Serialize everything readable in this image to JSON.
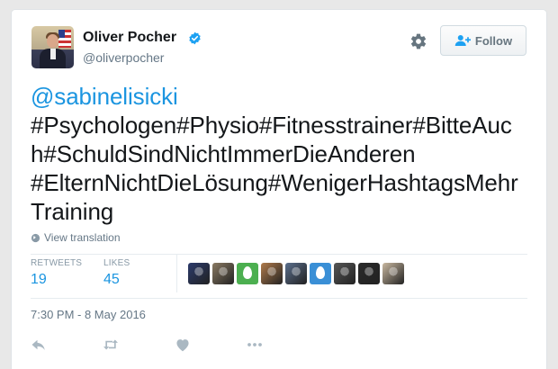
{
  "user": {
    "name": "Oliver Pocher",
    "handle": "@oliverpocher",
    "avatar_icon": "profile-photo",
    "verified_icon": "verified-badge-icon"
  },
  "header": {
    "settings_icon": "gear-icon",
    "follow_label": "Follow",
    "follow_icon": "add-user-icon"
  },
  "tweet": {
    "mention": "@sabinelisicki",
    "lines": [
      "#Psychologen#Physio#Fitnesstrainer#BitteAuc",
      "h#SchuldSindNichtImmerDieAnderen",
      "#ElternNichtDieLösung#WenigerHashtagsMehr",
      "Training"
    ],
    "translation_label": "View translation",
    "translation_icon": "globe-icon"
  },
  "stats": {
    "retweets_label": "RETWEETS",
    "retweets_count": "19",
    "likes_label": "LIKES",
    "likes_count": "45"
  },
  "likers": [
    {
      "icon": "liker-avatar-photo",
      "color": "#2b3a6b"
    },
    {
      "icon": "liker-avatar-photo",
      "color": "#8a7a62"
    },
    {
      "icon": "default-egg-avatar",
      "color": "#4caf50"
    },
    {
      "icon": "liker-avatar-photo",
      "color": "#b07a4a"
    },
    {
      "icon": "liker-avatar-photo",
      "color": "#5a6e8c"
    },
    {
      "icon": "default-egg-avatar",
      "color": "#3a8fd6"
    },
    {
      "icon": "liker-avatar-photo",
      "color": "#555555"
    },
    {
      "icon": "liker-avatar-photo",
      "color": "#2a2a2a"
    },
    {
      "icon": "liker-avatar-photo",
      "color": "#c9b8a0"
    }
  ],
  "timestamp": "7:30 PM - 8 May 2016",
  "actions": {
    "reply_icon": "reply-icon",
    "retweet_icon": "retweet-icon",
    "like_icon": "heart-icon",
    "more_icon": "more-dots-icon"
  },
  "colors": {
    "link_blue": "#1b95e0",
    "verified_blue": "#1da1f2",
    "text_dark": "#14171a",
    "text_muted": "#657786",
    "icon_gray": "#aab8c2"
  }
}
